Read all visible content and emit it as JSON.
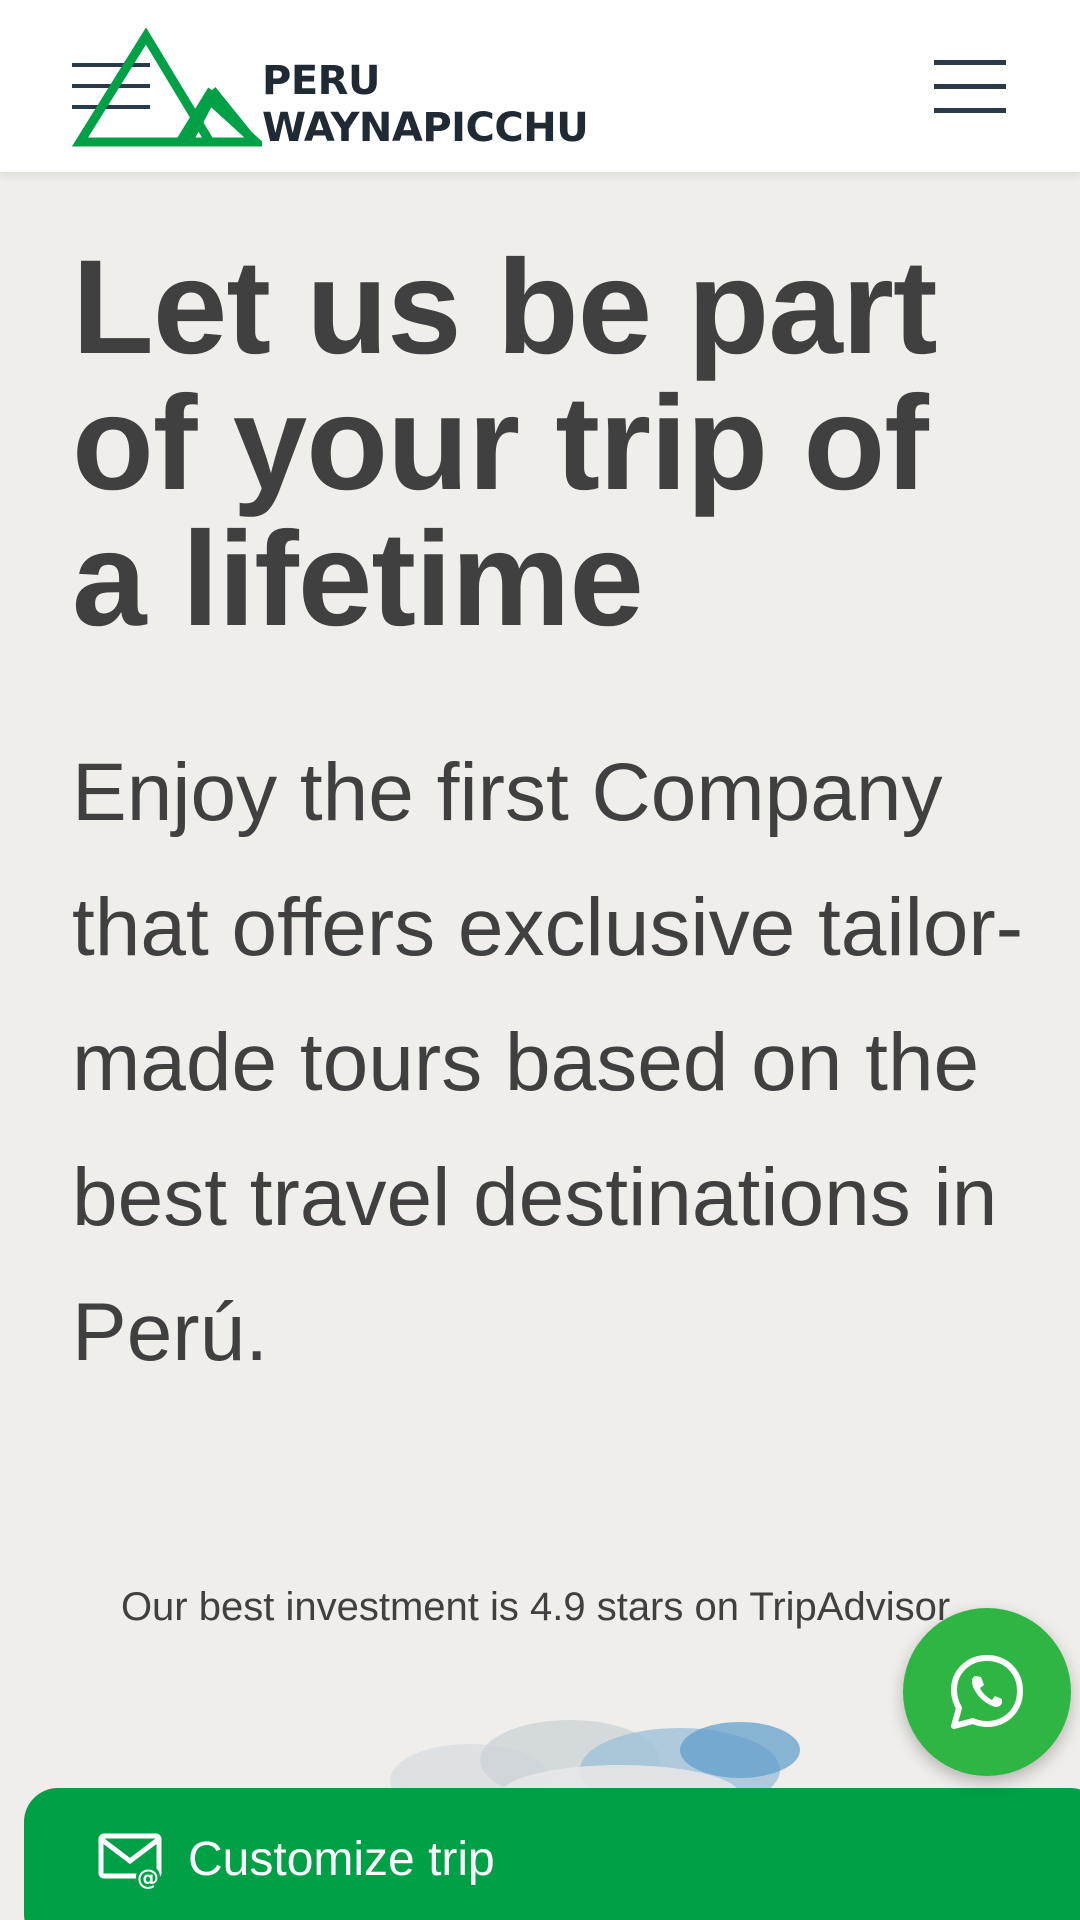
{
  "brand": {
    "line1": "PERU",
    "line2": "WAYNAPICCHU",
    "logo_icon": "mountain-logo-icon",
    "accent": "#00a047"
  },
  "header": {
    "menu_icon": "hamburger-menu-icon"
  },
  "hero": {
    "title": "Let us be part of your trip of a lifetime",
    "subtitle": "Enjoy the first Company that offers exclusive tailor-made tours based on the best travel destinations in Perú.",
    "rating_text": "Our best investment is 4.9 stars on TripAdvisor."
  },
  "fab": {
    "icon": "whatsapp-icon",
    "color": "#2fb544"
  },
  "cta": {
    "label": "Customize trip",
    "icon": "email-icon",
    "color": "#00a047"
  }
}
